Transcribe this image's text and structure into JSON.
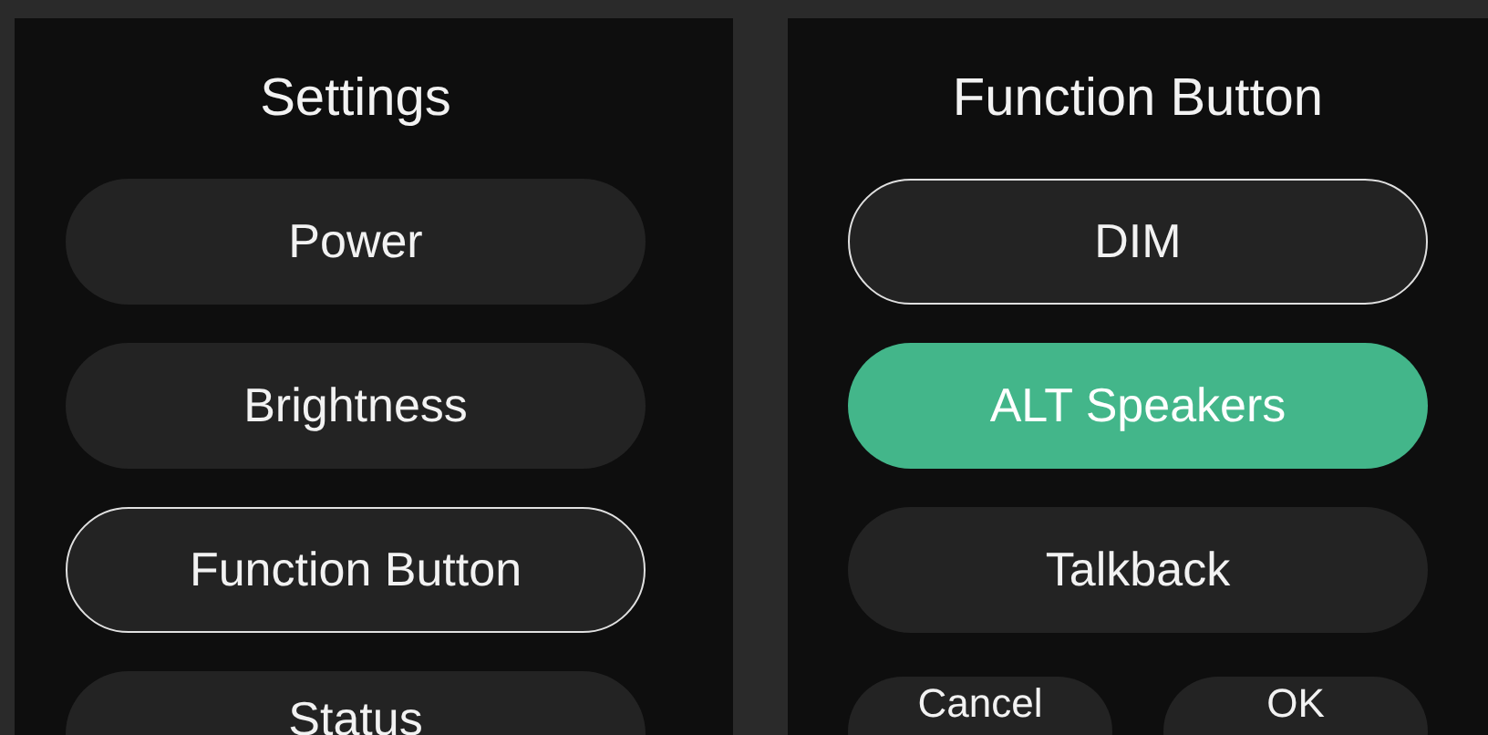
{
  "settings": {
    "title": "Settings",
    "items": [
      {
        "label": "Power",
        "selected": false
      },
      {
        "label": "Brightness",
        "selected": false
      },
      {
        "label": "Function Button",
        "selected": true
      },
      {
        "label": "Status",
        "selected": false
      }
    ]
  },
  "function_button": {
    "title": "Function Button",
    "options": [
      {
        "label": "DIM",
        "selected": false,
        "focused": true
      },
      {
        "label": "ALT Speakers",
        "selected": true,
        "focused": false
      },
      {
        "label": "Talkback",
        "selected": false,
        "focused": false
      }
    ],
    "actions": [
      "Cancel",
      "OK"
    ]
  }
}
